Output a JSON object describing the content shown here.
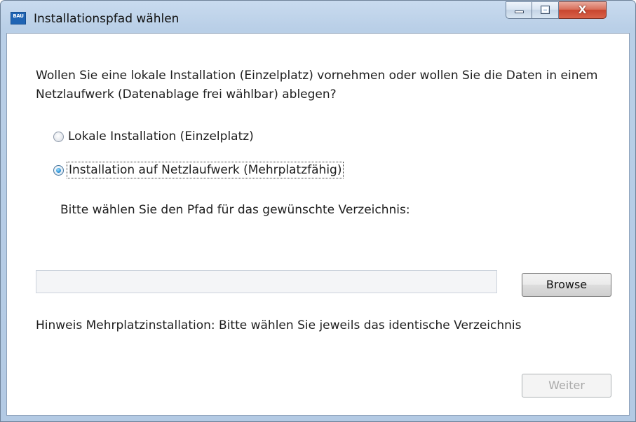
{
  "window": {
    "title": "Installationspfad wählen",
    "app_icon_text": "BAU",
    "close_glyph": "X"
  },
  "content": {
    "question": "Wollen Sie eine lokale Installation (Einzelplatz) vornehmen oder wollen Sie die Daten in einem Netzlaufwerk (Datenablage frei wählbar) ablegen?",
    "options": [
      {
        "label": "Lokale Installation (Einzelplatz)",
        "checked": false
      },
      {
        "label": "Installation auf Netzlaufwerk (Mehrplatzfähig)",
        "checked": true
      }
    ],
    "path_prompt": "Bitte wählen Sie den Pfad für das gewünschte Verzeichnis:",
    "path_value": "",
    "browse_label": "Browse",
    "hint": "Hinweis Mehrplatzinstallation: Bitte wählen Sie jeweils das identische Verzeichnis",
    "next_label": "Weiter"
  },
  "colors": {
    "titlebar": "#b9cfe7",
    "close_button": "#c8452f",
    "radio_selected": "#2f95d8"
  },
  "icons": [
    "app-icon",
    "minimize-icon",
    "maximize-icon",
    "close-icon"
  ]
}
